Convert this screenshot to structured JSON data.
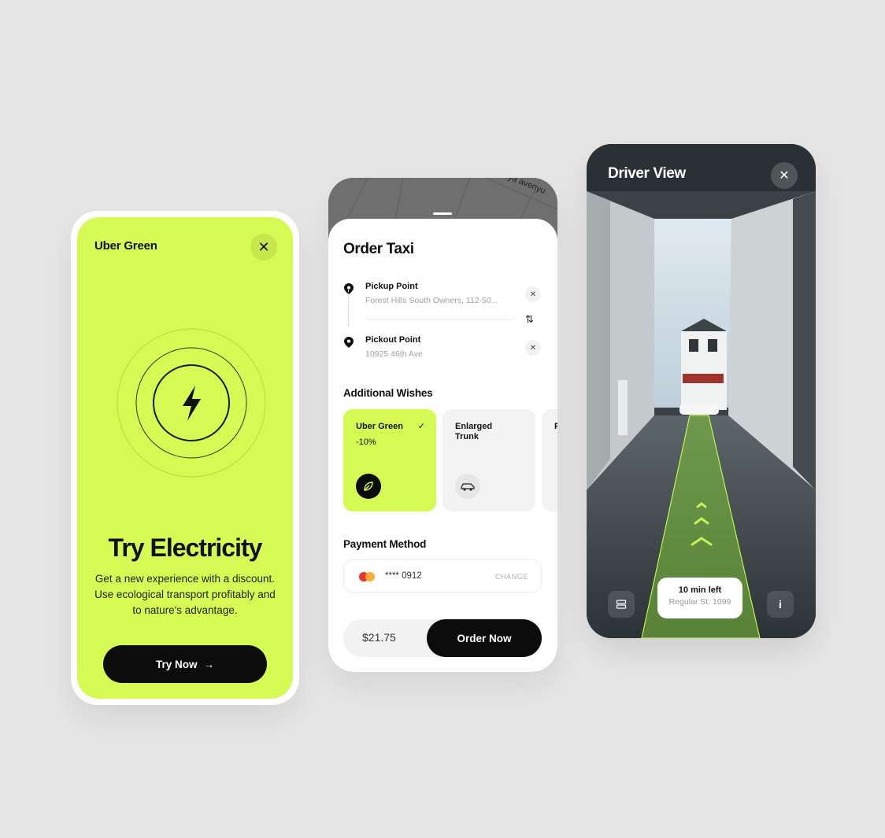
{
  "phone1": {
    "brand": "Uber Green",
    "title": "Try Electricity",
    "description": "Get a new experience with a discount. Use ecological transport profitably and to nature's advantage.",
    "cta_label": "Try Now",
    "accent_color": "#d6fa54",
    "icons": [
      "close-icon",
      "lightning-icon",
      "arrow-right-icon"
    ]
  },
  "phone2": {
    "map_street": "ya avenyu",
    "title": "Order Taxi",
    "pickup": {
      "label": "Pickup Point",
      "address": "Forest Hills South Owners, 112-50..."
    },
    "dropoff": {
      "label": "Pickout Point",
      "address": "10925 46th Ave"
    },
    "wishes_title": "Additional Wishes",
    "wishes": [
      {
        "title": "Uber Green",
        "subtitle": "-10%",
        "selected": true,
        "icon": "leaf-icon"
      },
      {
        "title": "Enlarged Trunk",
        "subtitle": "",
        "selected": false,
        "icon": "car-icon"
      },
      {
        "title": "P",
        "subtitle": "",
        "selected": false,
        "icon": ""
      }
    ],
    "payment_title": "Payment Method",
    "card_number": "**** 0912",
    "change_label": "CHANGE",
    "price": "$21.75",
    "order_label": "Order Now"
  },
  "phone3": {
    "title": "Driver View",
    "eta_title": "10 min left",
    "eta_address": "Regular St. 1099",
    "icons": [
      "close-icon",
      "layers-icon",
      "info-icon",
      "chevron-up-icon"
    ]
  }
}
